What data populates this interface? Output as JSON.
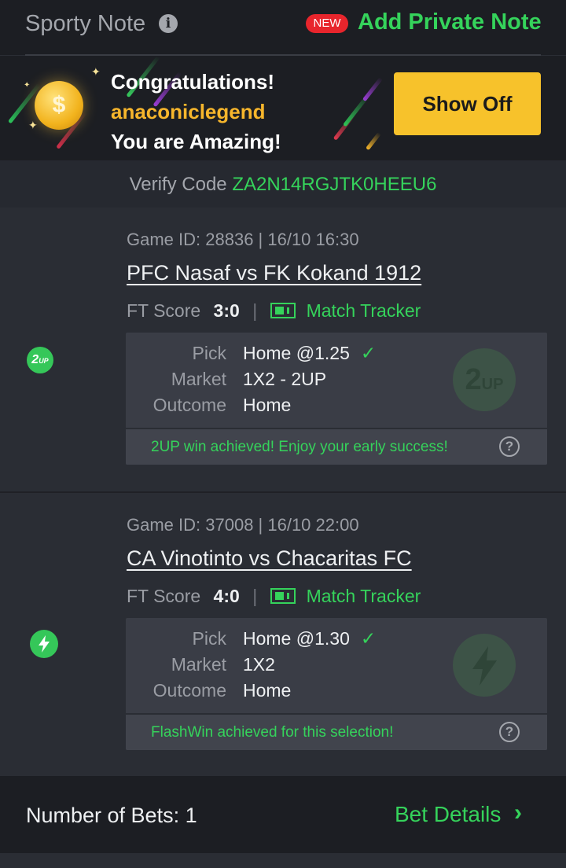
{
  "header": {
    "title": "Sporty Note",
    "new_badge": "NEW",
    "add_note_label": "Add Private Note"
  },
  "banner": {
    "line1": "Congratulations!",
    "username": "anaconiclegend",
    "line3": "You are Amazing!",
    "show_off_label": "Show Off",
    "coin_symbol": "$"
  },
  "verify": {
    "label": "Verify Code",
    "code": "ZA2N14RGJTK0HEEU6"
  },
  "bets": [
    {
      "badge": "2UP",
      "game_id": "Game ID: 28836 | 16/10 16:30",
      "match": "PFC Nasaf vs FK Kokand 1912",
      "ft_label": "FT Score",
      "ft_score": "3:0",
      "tracker_label": "Match Tracker",
      "pick_label": "Pick",
      "pick_value": "Home @1.25",
      "market_label": "Market",
      "market_value": "1X2 - 2UP",
      "outcome_label": "Outcome",
      "outcome_value": "Home",
      "message": "2UP win achieved! Enjoy your early success!"
    },
    {
      "badge": "flash-icon",
      "game_id": "Game ID: 37008 | 16/10 22:00",
      "match": "CA Vinotinto vs Chacaritas FC",
      "ft_label": "FT Score",
      "ft_score": "4:0",
      "tracker_label": "Match Tracker",
      "pick_label": "Pick",
      "pick_value": "Home @1.30",
      "market_label": "Market",
      "market_value": "1X2",
      "outcome_label": "Outcome",
      "outcome_value": "Home",
      "message": "FlashWin achieved for this selection!"
    }
  ],
  "footer": {
    "count_label": "Number of Bets: 1",
    "details_label": "Bet Details"
  },
  "colors": {
    "accent_green": "#35d35b",
    "gold": "#f7c22b",
    "badge_red": "#e8252c"
  }
}
